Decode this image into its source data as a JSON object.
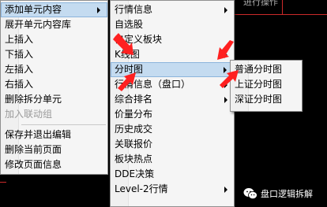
{
  "background": {
    "title_fragment": "进行操作",
    "color": "#000000",
    "line_color": "#cc2a2a"
  },
  "menu_main": {
    "items": [
      {
        "label": "添加单元内容",
        "highlighted": true,
        "submenu": true
      },
      {
        "label": "展开单元内容库"
      },
      {
        "label": "上插入"
      },
      {
        "label": "下插入"
      },
      {
        "label": "左插入"
      },
      {
        "label": "右插入"
      },
      {
        "label": "删除拆分单元"
      },
      {
        "label": "加入联动组",
        "disabled": true
      },
      {
        "label": "保存并退出编辑"
      },
      {
        "label": "删除当前页面"
      },
      {
        "label": "修改页面信息"
      }
    ]
  },
  "menu_content": {
    "items": [
      {
        "label": "行情信息",
        "submenu": true
      },
      {
        "label": "自选股"
      },
      {
        "label": "自定义板块"
      },
      {
        "label": "K线图",
        "submenu": true
      },
      {
        "label": "分时图",
        "highlighted": true,
        "submenu": true
      },
      {
        "label": "行情信息（盘口）",
        "submenu": true
      },
      {
        "label": "综合排名",
        "submenu": true
      },
      {
        "label": "价量分布"
      },
      {
        "label": "历史成交"
      },
      {
        "label": "关联报价"
      },
      {
        "label": "板块热点"
      },
      {
        "label": "DDE决策"
      },
      {
        "label": "Level-2行情",
        "submenu": true
      }
    ]
  },
  "menu_timechart": {
    "items": [
      {
        "label": "普通分时图"
      },
      {
        "label": "上证分时图"
      },
      {
        "label": "深证分时图"
      }
    ]
  },
  "watermark": {
    "text": "盘口逻辑拆解",
    "icon": "wechat-icon"
  },
  "annotation_color": "#ff2020"
}
